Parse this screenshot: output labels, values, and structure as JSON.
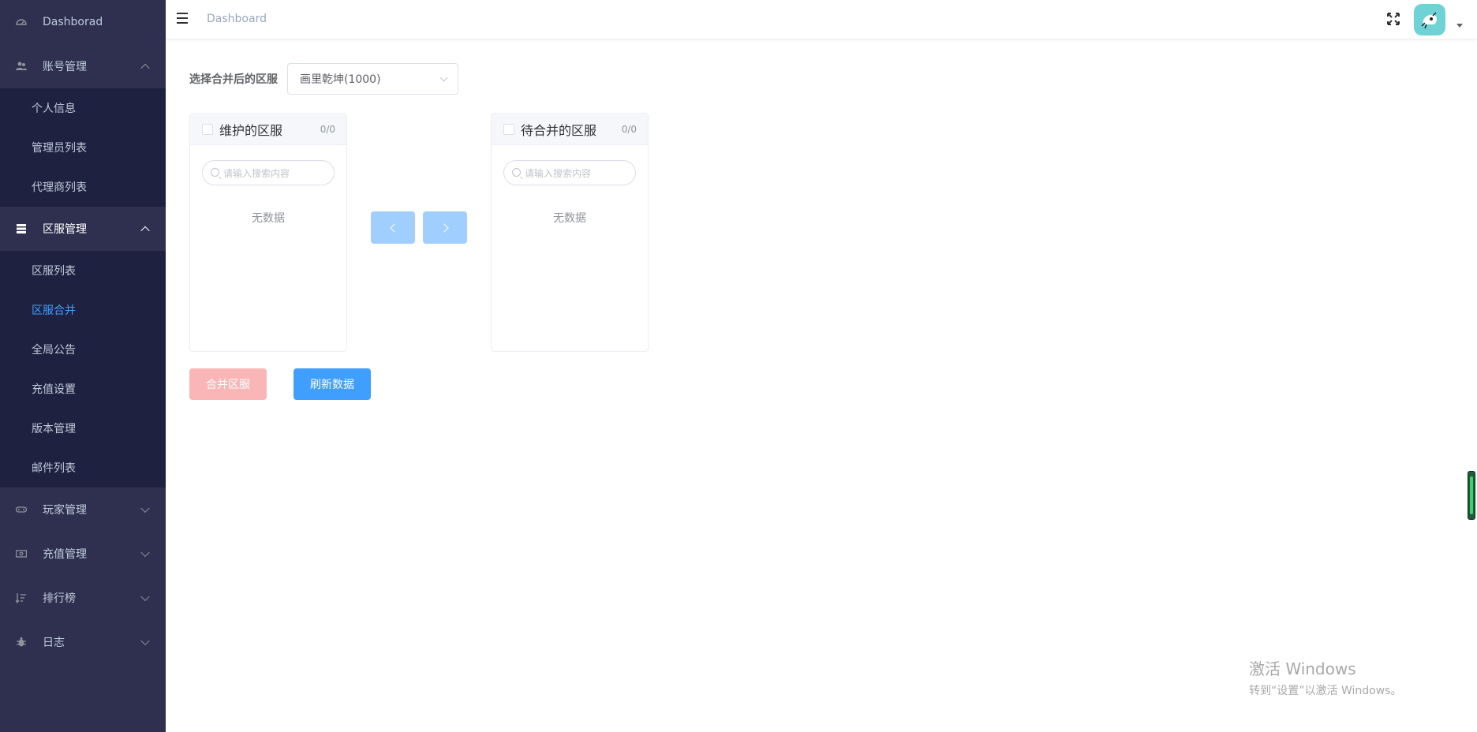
{
  "sidebar": {
    "items": [
      {
        "label": "Dashborad"
      },
      {
        "label": "账号管理",
        "children": [
          "个人信息",
          "管理员列表",
          "代理商列表"
        ]
      },
      {
        "label": "区服管理",
        "children": [
          "区服列表",
          "区服合并",
          "全局公告",
          "充值设置",
          "版本管理",
          "邮件列表"
        ]
      },
      {
        "label": "玩家管理"
      },
      {
        "label": "充值管理"
      },
      {
        "label": "排行榜"
      },
      {
        "label": "日志"
      }
    ],
    "current": "区服合并"
  },
  "header": {
    "breadcrumb": "Dashboard"
  },
  "form": {
    "label": "选择合并后的区服",
    "selected": "画里乾坤(1000)"
  },
  "transfer": {
    "left": {
      "title": "维护的区服",
      "count": "0/0",
      "search_placeholder": "请输入搜索内容",
      "empty": "无数据"
    },
    "right": {
      "title": "待合并的区服",
      "count": "0/0",
      "search_placeholder": "请输入搜索内容",
      "empty": "无数据"
    }
  },
  "buttons": {
    "merge": "合并区服",
    "refresh": "刷新数据"
  },
  "watermark": {
    "title": "激活 Windows",
    "subtitle": "转到“设置”以激活 Windows。"
  },
  "colors": {
    "sidebar_bg": "#2f3050",
    "submenu_bg": "#1f2140",
    "primary": "#409eff",
    "danger_disabled": "#fab6b6",
    "primary_disabled": "#a0cfff"
  }
}
